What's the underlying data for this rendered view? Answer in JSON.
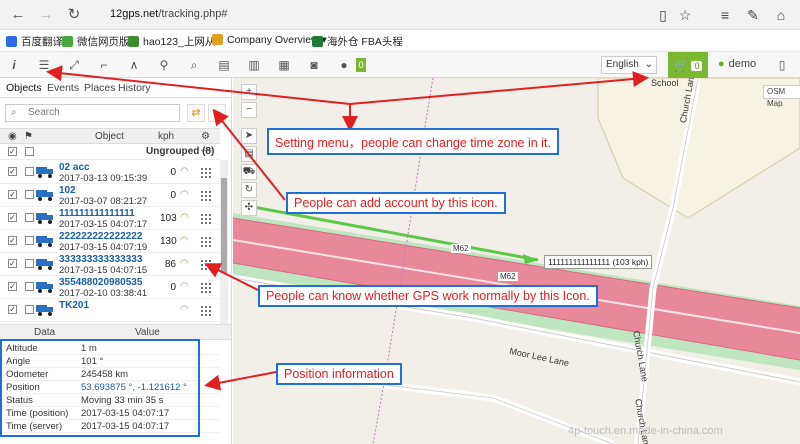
{
  "browser": {
    "url_domain": "12gps.net",
    "url_path": "/tracking.php#",
    "bookmarks": [
      "百度翻译",
      "微信网页版",
      "hao123_上网从",
      "Company Overview ▾",
      "海外仓 FBA头程"
    ]
  },
  "toolbar": {
    "language": "English",
    "cart_count": "0",
    "user": "demo"
  },
  "tabs": [
    "Objects",
    "Events",
    "Places",
    "History"
  ],
  "search": {
    "placeholder": "Search"
  },
  "objects_header": {
    "object": "Object",
    "speed": "kph"
  },
  "group": {
    "label": "Ungrouped (8)",
    "toggle": "—"
  },
  "objects": [
    {
      "name": "02 acc",
      "time": "2017-03-13 09:15:39",
      "speed": "0",
      "signal_color": "#999999"
    },
    {
      "name": "102",
      "time": "2017-03-07 08:21:27",
      "speed": "0",
      "signal_color": "#999999"
    },
    {
      "name": "111111111111111",
      "time": "2017-03-15 04:07:17",
      "speed": "103",
      "signal_color": "#7cb832"
    },
    {
      "name": "222222222222222",
      "time": "2017-03-15 04:07:19",
      "speed": "130",
      "signal_color": "#7cb832"
    },
    {
      "name": "333333333333333",
      "time": "2017-03-15 04:07:15",
      "speed": "86",
      "signal_color": "#7cb832"
    },
    {
      "name": "355488020980535",
      "time": "2017-02-10 03:38:41",
      "speed": "0",
      "signal_color": "#999999"
    },
    {
      "name": "TK201",
      "time": "",
      "speed": "",
      "signal_color": "#999999"
    }
  ],
  "data_header": {
    "data": "Data",
    "value": "Value"
  },
  "data_rows": [
    {
      "key": "Altitude",
      "value": "1 m"
    },
    {
      "key": "Angle",
      "value": "101 °"
    },
    {
      "key": "Odometer",
      "value": "245458 km"
    },
    {
      "key": "Position",
      "value": "53.693875 °, -1.121612 °"
    },
    {
      "key": "Status",
      "value": "Moving 33 min 35 s"
    },
    {
      "key": "Time (position)",
      "value": "2017-03-15 04:07:17"
    },
    {
      "key": "Time (server)",
      "value": "2017-03-15 04:07:17"
    }
  ],
  "map": {
    "labels": {
      "school": "School",
      "church_lane": "Church Lane",
      "moor_lee_lane": "Moor Lee Lane",
      "m62_a": "M62",
      "m62_b": "M62",
      "osm": "OSM Map"
    },
    "vehicle_label": "111111111111111 (103 kph)"
  },
  "annotations": {
    "setting": "Setting menu，people can change time zone in it.",
    "account": "People can add account by this icon.",
    "gps": "People can know whether GPS work normally by this Icon.",
    "position": "Position information"
  },
  "watermark": "4p-touch.en.made-in-china.com",
  "colors": {
    "accent": "#7cb832",
    "annotation_border": "#1f6fd6",
    "annotation_text": "#e02020",
    "motorway": "#e8899b"
  }
}
